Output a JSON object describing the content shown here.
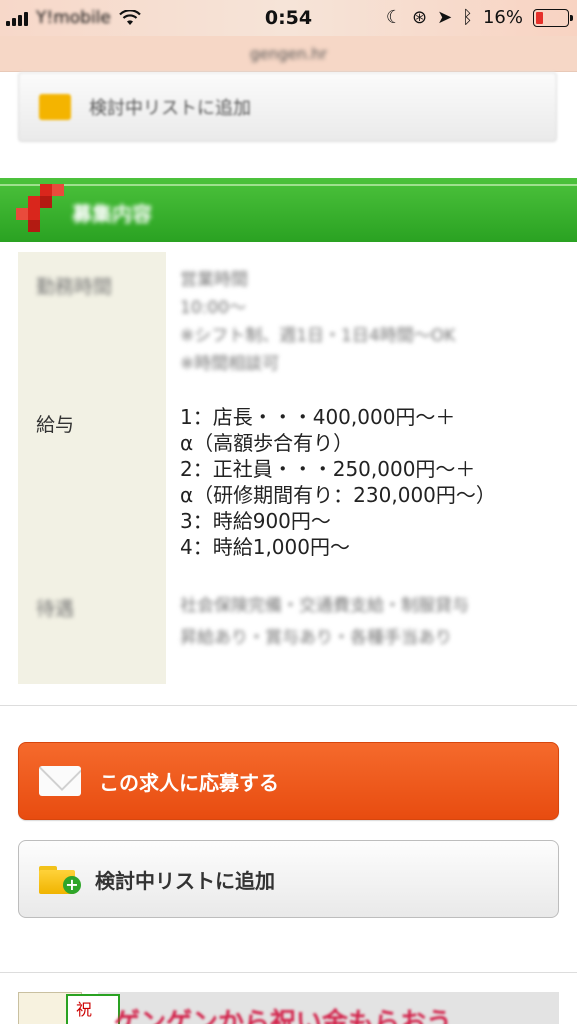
{
  "status_bar": {
    "carrier": "Y!mobile",
    "time": "0:54",
    "battery": "16%"
  },
  "url_bar": {
    "url": "gengen.hr"
  },
  "top_add": {
    "label": "検討中リストに追加"
  },
  "section": {
    "title": "募集内容"
  },
  "table": {
    "rows": [
      {
        "label": "勤務時間",
        "lines": [
          "営業時間",
          "10:00〜",
          "※シフト制、週1日・1日4時間〜OK",
          "※時間相談可"
        ],
        "blurred": true
      },
      {
        "label": "給与",
        "lines": [
          "1：店長・・・400,000円〜＋",
          "α（高額歩合有り）",
          "2：正社員・・・250,000円〜＋",
          "α（研修期間有り：230,000円〜）",
          "3：時給900円〜",
          "4：時給1,000円〜"
        ],
        "blurred": false
      },
      {
        "label": "待遇",
        "lines": [
          "社会保険完備・交通費支給・制服貸与",
          "昇給あり・賞与あり・各種手当あり"
        ],
        "blurred": true
      }
    ]
  },
  "apply_button": {
    "label": "この求人に応募する"
  },
  "add_list_button": {
    "label": "検討中リストに追加"
  },
  "banner": {
    "badge": "祝",
    "text": "ゲンゲンから祝い金もらおう"
  },
  "colors": {
    "green": "#2aa222",
    "orange": "#ef5a1d",
    "label_bg": "#f2f1e4"
  }
}
